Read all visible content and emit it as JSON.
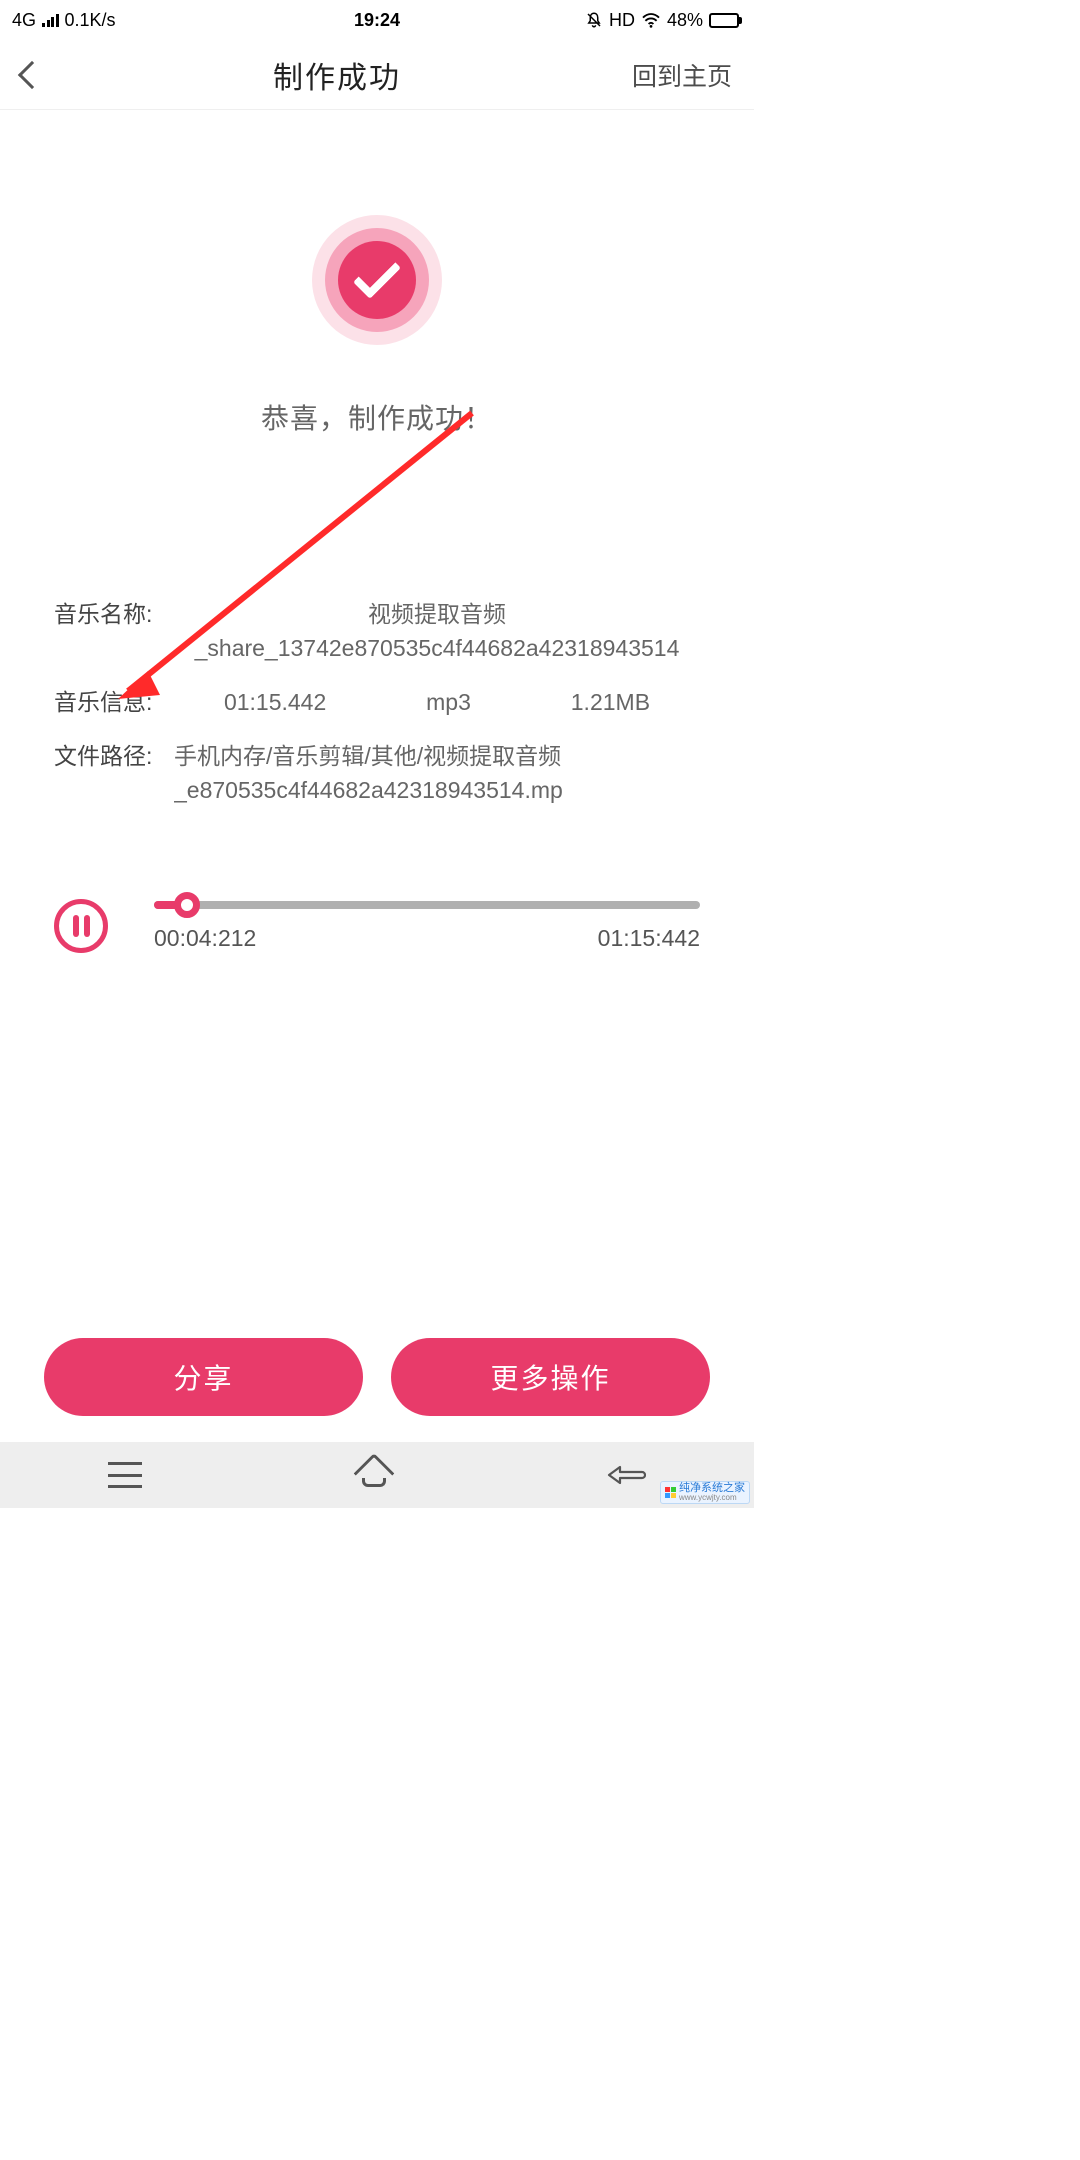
{
  "statusbar": {
    "network": "4G",
    "speed": "0.1K/s",
    "time": "19:24",
    "hd": "HD",
    "battery_pct": "48%"
  },
  "header": {
    "title": "制作成功",
    "home": "回到主页"
  },
  "success": {
    "message": "恭喜，制作成功！"
  },
  "info": {
    "name_label": "音乐名称:",
    "name_value": "视频提取音频_share_13742e870535c4f44682a42318943514",
    "meta_label": "音乐信息:",
    "duration": "01:15.442",
    "format": "mp3",
    "size": "1.21MB",
    "path_label": "文件路径:",
    "path_value": "手机内存/音乐剪辑/其他/视频提取音频_e870535c4f44682a42318943514.mp"
  },
  "player": {
    "current": "00:04:212",
    "total": "01:15:442"
  },
  "actions": {
    "share": "分享",
    "more": "更多操作"
  },
  "watermark": {
    "name": "纯净系统之家",
    "url": "www.ycwjty.com"
  }
}
